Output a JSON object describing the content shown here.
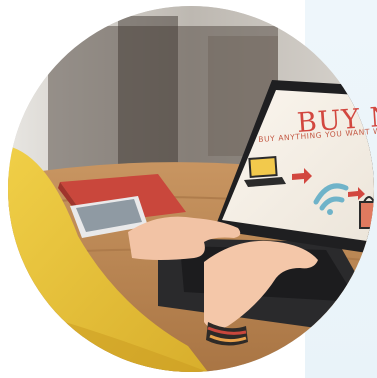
{
  "photo": {
    "description_key": "photo",
    "screen_headline": "BUY NOW",
    "screen_subline": "BUY ANYTHING YOU WANT WITH JUST",
    "icons": [
      "laptop-icon",
      "wifi-icon",
      "shopping-bag-icon",
      "arrow-right-icon"
    ],
    "colors": {
      "background": "#ffffff",
      "backdrop": "#eaf4fa",
      "headline": "#d2473f",
      "sleeve": "#e6c23a",
      "table": "#b9834f",
      "laptop": "#2a2a2c",
      "screen": "#f4efe6"
    }
  }
}
